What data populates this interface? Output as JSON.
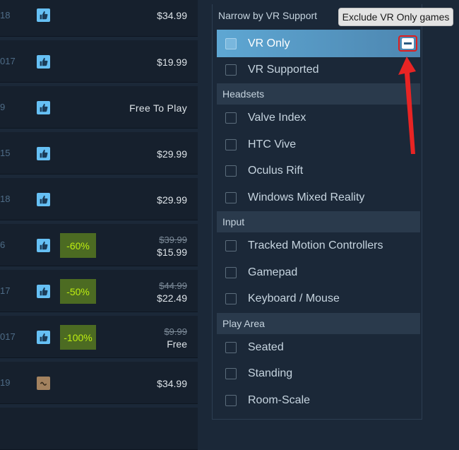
{
  "results": [
    {
      "date": "18",
      "review": "positive",
      "price": "$34.99"
    },
    {
      "date": "017",
      "review": "positive",
      "price": "$19.99"
    },
    {
      "date": "9",
      "review": "positive",
      "price": "Free To Play"
    },
    {
      "date": "15",
      "review": "positive",
      "price": "$29.99"
    },
    {
      "date": "18",
      "review": "positive",
      "price": "$29.99"
    },
    {
      "date": "6",
      "review": "positive",
      "discount": "-60%",
      "original_price": "$39.99",
      "final_price": "$15.99"
    },
    {
      "date": "17",
      "review": "positive",
      "discount": "-50%",
      "original_price": "$44.99",
      "final_price": "$22.49"
    },
    {
      "date": "017",
      "review": "positive",
      "discount": "-100%",
      "original_price": "$9.99",
      "final_price": "Free"
    },
    {
      "date": "19",
      "review": "mixed",
      "price": "$34.99"
    }
  ],
  "filter": {
    "title": "Narrow by VR Support",
    "vr_options": [
      {
        "label": "VR Only",
        "active": true
      },
      {
        "label": "VR Supported",
        "active": false
      }
    ],
    "headsets_title": "Headsets",
    "headsets": [
      "Valve Index",
      "HTC Vive",
      "Oculus Rift",
      "Windows Mixed Reality"
    ],
    "input_title": "Input",
    "inputs": [
      "Tracked Motion Controllers",
      "Gamepad",
      "Keyboard / Mouse"
    ],
    "play_area_title": "Play Area",
    "play_areas": [
      "Seated",
      "Standing",
      "Room-Scale"
    ]
  },
  "tooltip": "Exclude VR Only games",
  "colors": {
    "background": "#1b2838",
    "active_row": "#5ea7d3",
    "discount_bg": "#4c6b22",
    "discount_text": "#beee11",
    "annotation": "#e01d1d"
  },
  "icons": {
    "positive_review": "thumbs-up-icon",
    "mixed_review": "mixed-review-icon",
    "exclude": "minus-icon",
    "annotation": "red-arrow-icon"
  }
}
